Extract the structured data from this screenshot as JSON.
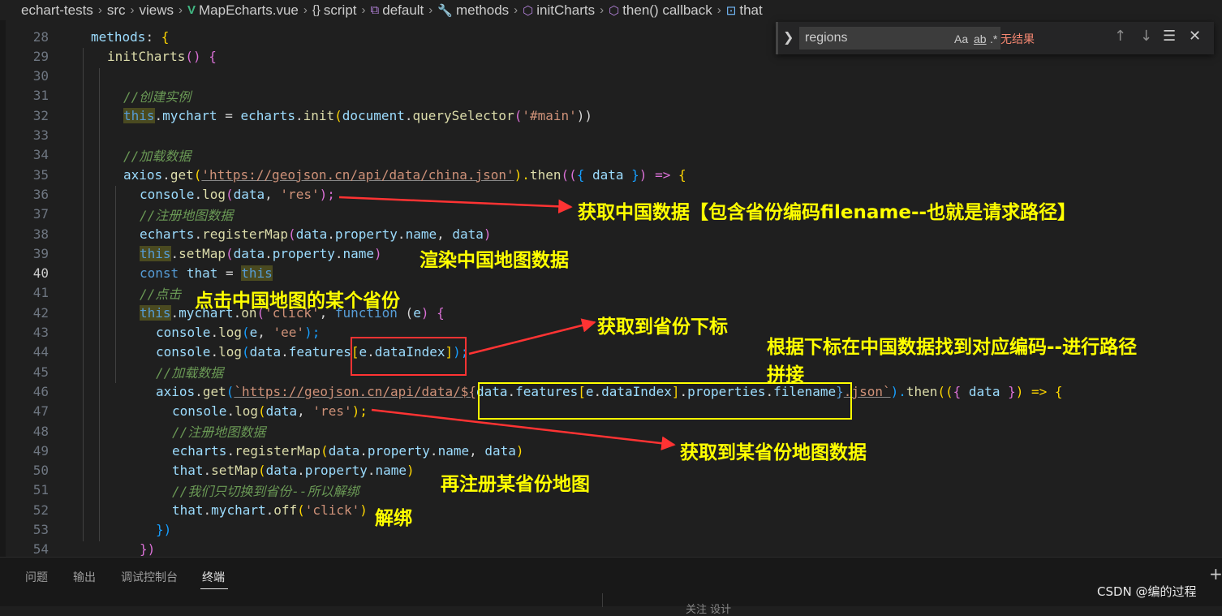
{
  "breadcrumb": [
    {
      "icon": "",
      "label": "echart-tests"
    },
    {
      "icon": "",
      "label": "src"
    },
    {
      "icon": "",
      "label": "views"
    },
    {
      "icon": "vue-file-icon",
      "label": "MapEcharts.vue"
    },
    {
      "icon": "braces-icon",
      "label": "script"
    },
    {
      "icon": "module-icon",
      "label": "default"
    },
    {
      "icon": "wrench-icon",
      "label": "methods"
    },
    {
      "icon": "cube-icon",
      "label": "initCharts"
    },
    {
      "icon": "cube-icon",
      "label": "then() callback"
    },
    {
      "icon": "variable-icon",
      "label": "that"
    }
  ],
  "find": {
    "value": "regions",
    "match_case": "Aa",
    "whole_word": "ab",
    "regex": ".*",
    "result": "无结果"
  },
  "editor": {
    "active_line": 40,
    "lines": [
      {
        "n": "28",
        "i": 0
      },
      {
        "n": "29",
        "i": 1
      },
      {
        "n": "30",
        "i": 2
      },
      {
        "n": "31",
        "i": 2
      },
      {
        "n": "32",
        "i": 2
      },
      {
        "n": "33",
        "i": 2
      },
      {
        "n": "34",
        "i": 2
      },
      {
        "n": "35",
        "i": 2
      },
      {
        "n": "36",
        "i": 3
      },
      {
        "n": "37",
        "i": 3
      },
      {
        "n": "38",
        "i": 3
      },
      {
        "n": "39",
        "i": 3
      },
      {
        "n": "40",
        "i": 3
      },
      {
        "n": "41",
        "i": 3
      },
      {
        "n": "42",
        "i": 3
      },
      {
        "n": "43",
        "i": 4
      },
      {
        "n": "44",
        "i": 4
      },
      {
        "n": "45",
        "i": 4
      },
      {
        "n": "46",
        "i": 4
      },
      {
        "n": "47",
        "i": 5
      },
      {
        "n": "48",
        "i": 5
      },
      {
        "n": "49",
        "i": 5
      },
      {
        "n": "50",
        "i": 5
      },
      {
        "n": "51",
        "i": 5
      },
      {
        "n": "52",
        "i": 5
      },
      {
        "n": "53",
        "i": 4
      },
      {
        "n": "54",
        "i": 3
      }
    ],
    "tokens": {
      "l28": [
        "methods",
        ": ",
        "{"
      ],
      "l29": [
        "initCharts",
        "() ",
        "{"
      ],
      "l31": [
        "//创建实例"
      ],
      "l32": [
        "this",
        ".",
        "mychart",
        " = ",
        "echarts",
        ".",
        "init",
        "(",
        "document",
        ".",
        "querySelector",
        "(",
        "'#main'",
        "))"
      ],
      "l34": [
        "//加载数据"
      ],
      "l35": [
        "axios",
        ".",
        "get",
        "(",
        "'https://geojson.cn/api/data/china.json'",
        ").",
        "then",
        "((",
        "{ ",
        "data",
        " }",
        ") => ",
        "{"
      ],
      "l36": [
        "console",
        ".",
        "log",
        "(",
        "data",
        ", ",
        "'res'",
        ");"
      ],
      "l37": [
        "//注册地图数据"
      ],
      "l38": [
        "echarts",
        ".",
        "registerMap",
        "(",
        "data",
        ".",
        "property",
        ".",
        "name",
        ", ",
        "data",
        ")"
      ],
      "l39": [
        "this",
        ".",
        "setMap",
        "(",
        "data",
        ".",
        "property",
        ".",
        "name",
        ")"
      ],
      "l40": [
        "const",
        " ",
        "that",
        " = ",
        "this"
      ],
      "l41": [
        "//点击"
      ],
      "l42": [
        "this",
        ".",
        "mychart",
        ".",
        "on",
        "(",
        "'click'",
        ", ",
        "function",
        " (",
        "e",
        ") ",
        "{"
      ],
      "l43": [
        "console",
        ".",
        "log",
        "(",
        "e",
        ", ",
        "'ee'",
        ");"
      ],
      "l44": [
        "console",
        ".",
        "log",
        "(",
        "data",
        ".",
        "features",
        "[",
        "e",
        ".",
        "dataIndex",
        "]",
        ");"
      ],
      "l45": [
        "//加载数据"
      ],
      "l46": [
        "axios",
        ".",
        "get",
        "(",
        "`https://geojson.cn/api/data/${",
        "data",
        ".",
        "features",
        "[",
        "e",
        ".",
        "dataIndex",
        "]",
        ".",
        "properties",
        ".",
        "filename",
        "}",
        ".json`",
        ").",
        "then",
        "((",
        "{ ",
        "data",
        " }",
        ") => ",
        "{"
      ],
      "l47": [
        "console",
        ".",
        "log",
        "(",
        "data",
        ", ",
        "'res'",
        ");"
      ],
      "l48": [
        "//注册地图数据"
      ],
      "l49": [
        "echarts",
        ".",
        "registerMap",
        "(",
        "data",
        ".",
        "property",
        ".",
        "name",
        ", ",
        "data",
        ")"
      ],
      "l50": [
        "that",
        ".",
        "setMap",
        "(",
        "data",
        ".",
        "property",
        ".",
        "name",
        ")"
      ],
      "l51": [
        "//我们只切换到省份--所以解绑"
      ],
      "l52": [
        "that",
        ".",
        "mychart",
        ".",
        "off",
        "(",
        "'click'",
        ")"
      ],
      "l53": [
        "})"
      ],
      "l54": [
        "})"
      ]
    }
  },
  "annotations": {
    "a1": "获取中国数据【包含省份编码filename--也就是请求路径】",
    "a2": "渲染中国地图数据",
    "a3": "点击中国地图的某个省份",
    "a4": "获取到省份下标",
    "a5_line1": "根据下标在中国数据找到对应编码--进行路径",
    "a5_line2": "拼接",
    "a6": "获取到某省份地图数据",
    "a7": "再注册某省份地图",
    "a8": "解绑"
  },
  "colors": {
    "annotation_text": "#ffff00",
    "arrow": "#ff3333",
    "red_box": "#ff3333",
    "yellow_box": "#ffff00"
  },
  "panel": {
    "tabs": [
      "问题",
      "输出",
      "调试控制台",
      "终端"
    ],
    "active_tab": "终端",
    "trailing": "关注 设计"
  },
  "watermark": "CSDN @编的过程"
}
